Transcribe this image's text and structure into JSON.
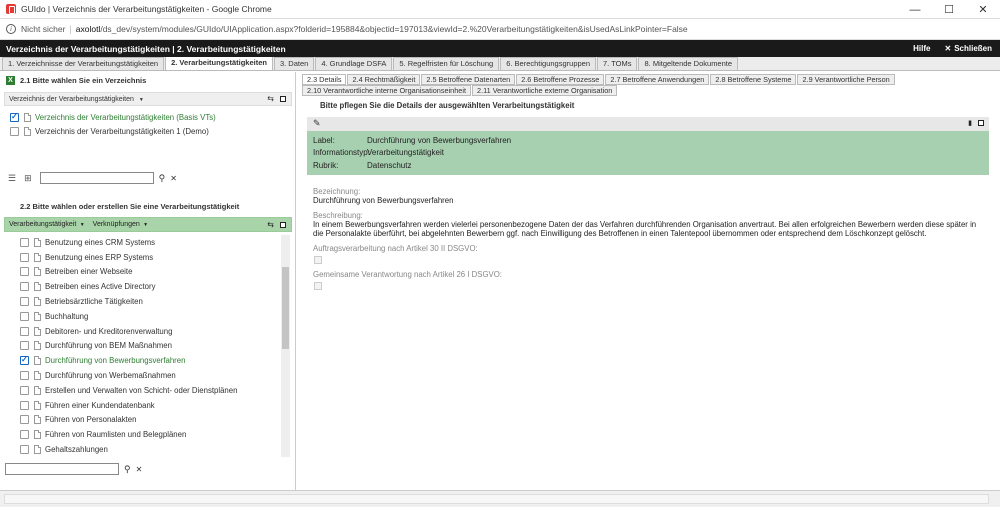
{
  "window": {
    "title": "GUIdo | Verzeichnis der Verarbeitungstätigkeiten - Google Chrome",
    "controls": {
      "minimize": "—",
      "maximize": "☐",
      "close": "✕"
    }
  },
  "address": {
    "insecure_label": "Nicht sicher",
    "host": "axolotl",
    "path": "/ds_dev/system/modules/GUIdo/UIApplication.aspx?folderid=195884&objectid=197013&viewId=2.%20Verarbeitungstätigkeiten&isUsedAsLinkPointer=False"
  },
  "app_header": {
    "title": "Verzeichnis der Verarbeitungstätigkeiten | 2. Verarbeitungstätigkeiten",
    "help": "Hilfe",
    "close": "Schließen"
  },
  "main_tabs": [
    {
      "label": "1. Verzeichnisse der Verarbeitungstätigkeiten",
      "active": false
    },
    {
      "label": "2. Verarbeitungstätigkeiten",
      "active": true
    },
    {
      "label": "3. Daten",
      "active": false
    },
    {
      "label": "4. Grundlage DSFA",
      "active": false
    },
    {
      "label": "5. Regelfristen für Löschung",
      "active": false
    },
    {
      "label": "6. Berechtigungsgruppen",
      "active": false
    },
    {
      "label": "7. TOMs",
      "active": false
    },
    {
      "label": "8. Mitgeltende Dokumente",
      "active": false
    }
  ],
  "left": {
    "section1_title": "2.1 Bitte wählen Sie ein Verzeichnis",
    "section1_dropdown": "Verzeichnis der Verarbeitungstätigkeiten",
    "directories": [
      {
        "label": "Verzeichnis der Verarbeitungstätigkeiten (Basis VTs)",
        "checked": true
      },
      {
        "label": "Verzeichnis der Verarbeitungstätigkeiten 1 (Demo)",
        "checked": false
      }
    ],
    "section2_title": "2.2 Bitte wählen oder erstellen Sie eine Verarbeitungstätigkeit",
    "section2_dropdown1": "Verarbeitungstätigkeit",
    "section2_dropdown2": "Verknüpfungen",
    "activities": [
      {
        "label": "Benutzung eines CRM Systems",
        "checked": false
      },
      {
        "label": "Benutzung eines ERP Systems",
        "checked": false
      },
      {
        "label": "Betreiben einer Webseite",
        "checked": false
      },
      {
        "label": "Betreiben eines Active Directory",
        "checked": false
      },
      {
        "label": "Betriebsärztliche Tätigkeiten",
        "checked": false
      },
      {
        "label": "Buchhaltung",
        "checked": false
      },
      {
        "label": "Debitoren- und Kreditorenverwaltung",
        "checked": false
      },
      {
        "label": "Durchführung von BEM Maßnahmen",
        "checked": false
      },
      {
        "label": "Durchführung von Bewerbungsverfahren",
        "checked": true
      },
      {
        "label": "Durchführung von Werbemaßnahmen",
        "checked": false
      },
      {
        "label": "Erstellen und Verwalten von Schicht- oder Dienstplänen",
        "checked": false
      },
      {
        "label": "Führen einer Kundendatenbank",
        "checked": false
      },
      {
        "label": "Führen von Personalakten",
        "checked": false
      },
      {
        "label": "Führen von Raumlisten und Belegplänen",
        "checked": false
      },
      {
        "label": "Gehaltszahlungen",
        "checked": false
      }
    ]
  },
  "right": {
    "sub_tabs_row1": [
      {
        "label": "2.3 Details",
        "active": true
      },
      {
        "label": "2.4 Rechtmäßigkeit",
        "active": false
      },
      {
        "label": "2.5 Betroffene Datenarten",
        "active": false
      },
      {
        "label": "2.6 Betroffene Prozesse",
        "active": false
      },
      {
        "label": "2.7 Betroffene Anwendungen",
        "active": false
      },
      {
        "label": "2.8 Betroffene Systeme",
        "active": false
      },
      {
        "label": "2.9 Verantwortliche Person",
        "active": false
      }
    ],
    "sub_tabs_row2": [
      {
        "label": "2.10 Verantwortliche interne Organisationseinheit",
        "active": false
      },
      {
        "label": "2.11 Verantwortliche externe Organisation",
        "active": false
      }
    ],
    "title": "Bitte pflegen Sie die Details der ausgewählten Verarbeitungstätigkeit",
    "info": {
      "label_key": "Label:",
      "label_value": "Durchführung von Bewerbungsverfahren",
      "type_key": "Informationstyp:",
      "type_value": "Verarbeitungstätigkeit",
      "rubric_key": "Rubrik:",
      "rubric_value": "Datenschutz"
    },
    "fields": {
      "name_label": "Bezeichnung:",
      "name_value": "Durchführung von Bewerbungsverfahren",
      "desc_label": "Beschreibung:",
      "desc_value": "In einem Bewerbungsverfahren werden vielerlei personenbezogene Daten der das Verfahren durchführenden Organisation anvertraut. Bei allen erfolgreichen Bewerbern werden diese später in die Personalakte überführt, bei abgelehnten Bewerbern ggf. nach Einwilligung des Betroffenen in einen Talentepool übernommen oder entsprechend dem Löschkonzept gelöscht.",
      "art30_label": "Auftragsverarbeitung nach Artikel 30 II DSGVO:",
      "art26_label": "Gemeinsame Verantwortung nach Artikel 26 I DSGVO:"
    }
  },
  "icons": [
    "info-icon",
    "excel-icon",
    "sort-icon",
    "maximize-icon",
    "list-icon",
    "tree-icon",
    "search-icon",
    "clear-icon",
    "pencil-icon",
    "document-icon"
  ]
}
